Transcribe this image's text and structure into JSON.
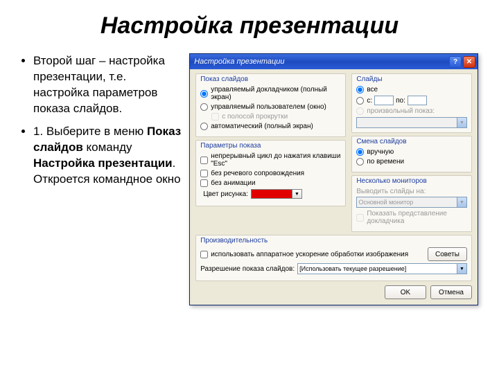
{
  "slide": {
    "title": "Настройка презентации",
    "bullet1": "Второй шаг – настройка презентации, т.е. настройка параметров показа слайдов.",
    "bullet2a": "1. Выберите в меню ",
    "bullet2b": "Показ слайдов",
    "bullet2c": " команду ",
    "bullet2d": "Настройка презентации",
    "bullet2e": ". Откроется командное окно"
  },
  "dlg": {
    "title": "Настройка презентации",
    "help": "?",
    "close": "✕",
    "show": {
      "title": "Показ слайдов",
      "opt1": "управляемый докладчиком (полный экран)",
      "opt2": "управляемый пользователем (окно)",
      "opt2sub": "с полосой прокрутки",
      "opt3": "автоматический (полный экран)"
    },
    "params": {
      "title": "Параметры показа",
      "chk1": "непрерывный цикл до нажатия клавиши \"Esc\"",
      "chk2": "без речевого сопровождения",
      "chk3": "без анимации",
      "colorLabel": "Цвет рисунка:"
    },
    "slides": {
      "title": "Слайды",
      "all": "все",
      "from": "с:",
      "to": "по:",
      "custom": "произвольный показ:"
    },
    "advance": {
      "title": "Смена слайдов",
      "opt1": "вручную",
      "opt2": "по времени"
    },
    "monitors": {
      "title": "Несколько мониторов",
      "outLabel": "Выводить слайды на:",
      "outValue": "Основной монитор",
      "presenter": "Показать представление докладчика"
    },
    "perf": {
      "title": "Производительность",
      "hw": "использовать аппаратное ускорение обработки изображения",
      "tips": "Советы",
      "resLabel": "Разрешение показа слайдов:",
      "resValue": "[Использовать текущее разрешение]"
    },
    "ok": "OK",
    "cancel": "Отмена"
  }
}
